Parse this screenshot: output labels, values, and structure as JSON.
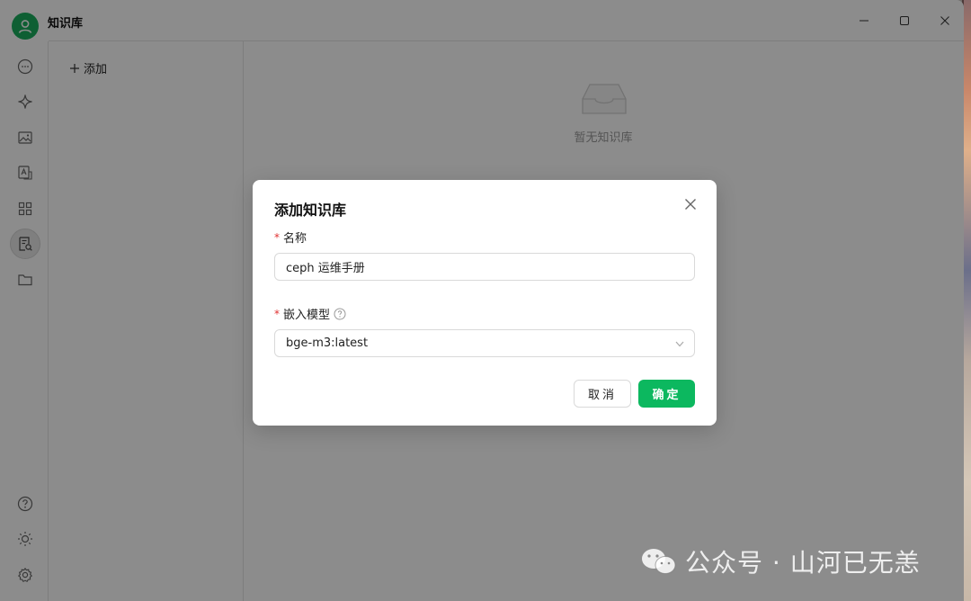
{
  "window": {
    "title": "知识库",
    "controls": {
      "minimize_icon": "minimize-icon",
      "maximize_icon": "maximize-icon",
      "close_icon": "close-icon"
    }
  },
  "sidebar": {
    "items": [
      {
        "name": "chat",
        "icon": "chat-bubble-icon"
      },
      {
        "name": "agents",
        "icon": "sparkle-icon"
      },
      {
        "name": "images",
        "icon": "image-icon"
      },
      {
        "name": "translate",
        "icon": "translate-icon"
      },
      {
        "name": "apps",
        "icon": "grid-icon"
      },
      {
        "name": "knowledge",
        "icon": "knowledge-base-icon",
        "active": true
      },
      {
        "name": "files",
        "icon": "folder-icon"
      }
    ],
    "bottom": [
      {
        "name": "help",
        "icon": "help-icon"
      },
      {
        "name": "theme",
        "icon": "sun-icon"
      },
      {
        "name": "settings",
        "icon": "gear-icon"
      }
    ]
  },
  "list_panel": {
    "add_label": "添加"
  },
  "content": {
    "empty_text": "暂无知识库"
  },
  "modal": {
    "title": "添加知识库",
    "name_label": "名称",
    "name_value": "ceph 运维手册",
    "model_label": "嵌入模型",
    "model_value": "bge-m3:latest",
    "cancel_label": "取消",
    "ok_label": "确定"
  },
  "watermark": {
    "text": "公众号 · 山河已无恙"
  },
  "colors": {
    "accent": "#0cb85f",
    "avatar": "#1aad5e",
    "required": "#e03131"
  }
}
